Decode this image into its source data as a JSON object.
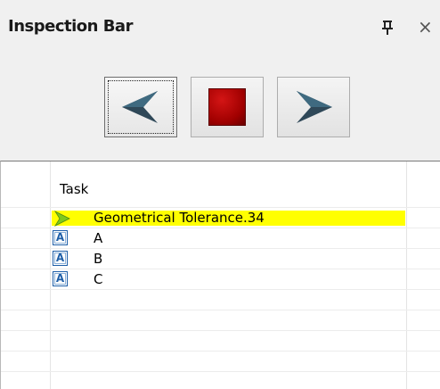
{
  "panel": {
    "title": "Inspection Bar",
    "pin_icon": "pin-icon",
    "close_label": "×"
  },
  "toolbar": {
    "buttons": [
      {
        "name": "previous",
        "icon": "arrow-left-icon"
      },
      {
        "name": "stop",
        "icon": "stop-icon"
      },
      {
        "name": "next",
        "icon": "arrow-right-icon"
      }
    ]
  },
  "grid": {
    "column_header": "Task",
    "rows": [
      {
        "label": "Geometrical Tolerance.34",
        "icon": "current-task-arrow-icon",
        "highlighted": true
      },
      {
        "label": "A",
        "icon": "datum-a-icon",
        "icon_text": "A"
      },
      {
        "label": "B",
        "icon": "datum-a-icon",
        "icon_text": "A"
      },
      {
        "label": "C",
        "icon": "datum-a-icon",
        "icon_text": "A"
      }
    ]
  },
  "colors": {
    "highlight": "#ffff00",
    "stop": "#b00000",
    "current_arrow": "#7ec81e",
    "datum_icon": "#1f5fa8"
  }
}
